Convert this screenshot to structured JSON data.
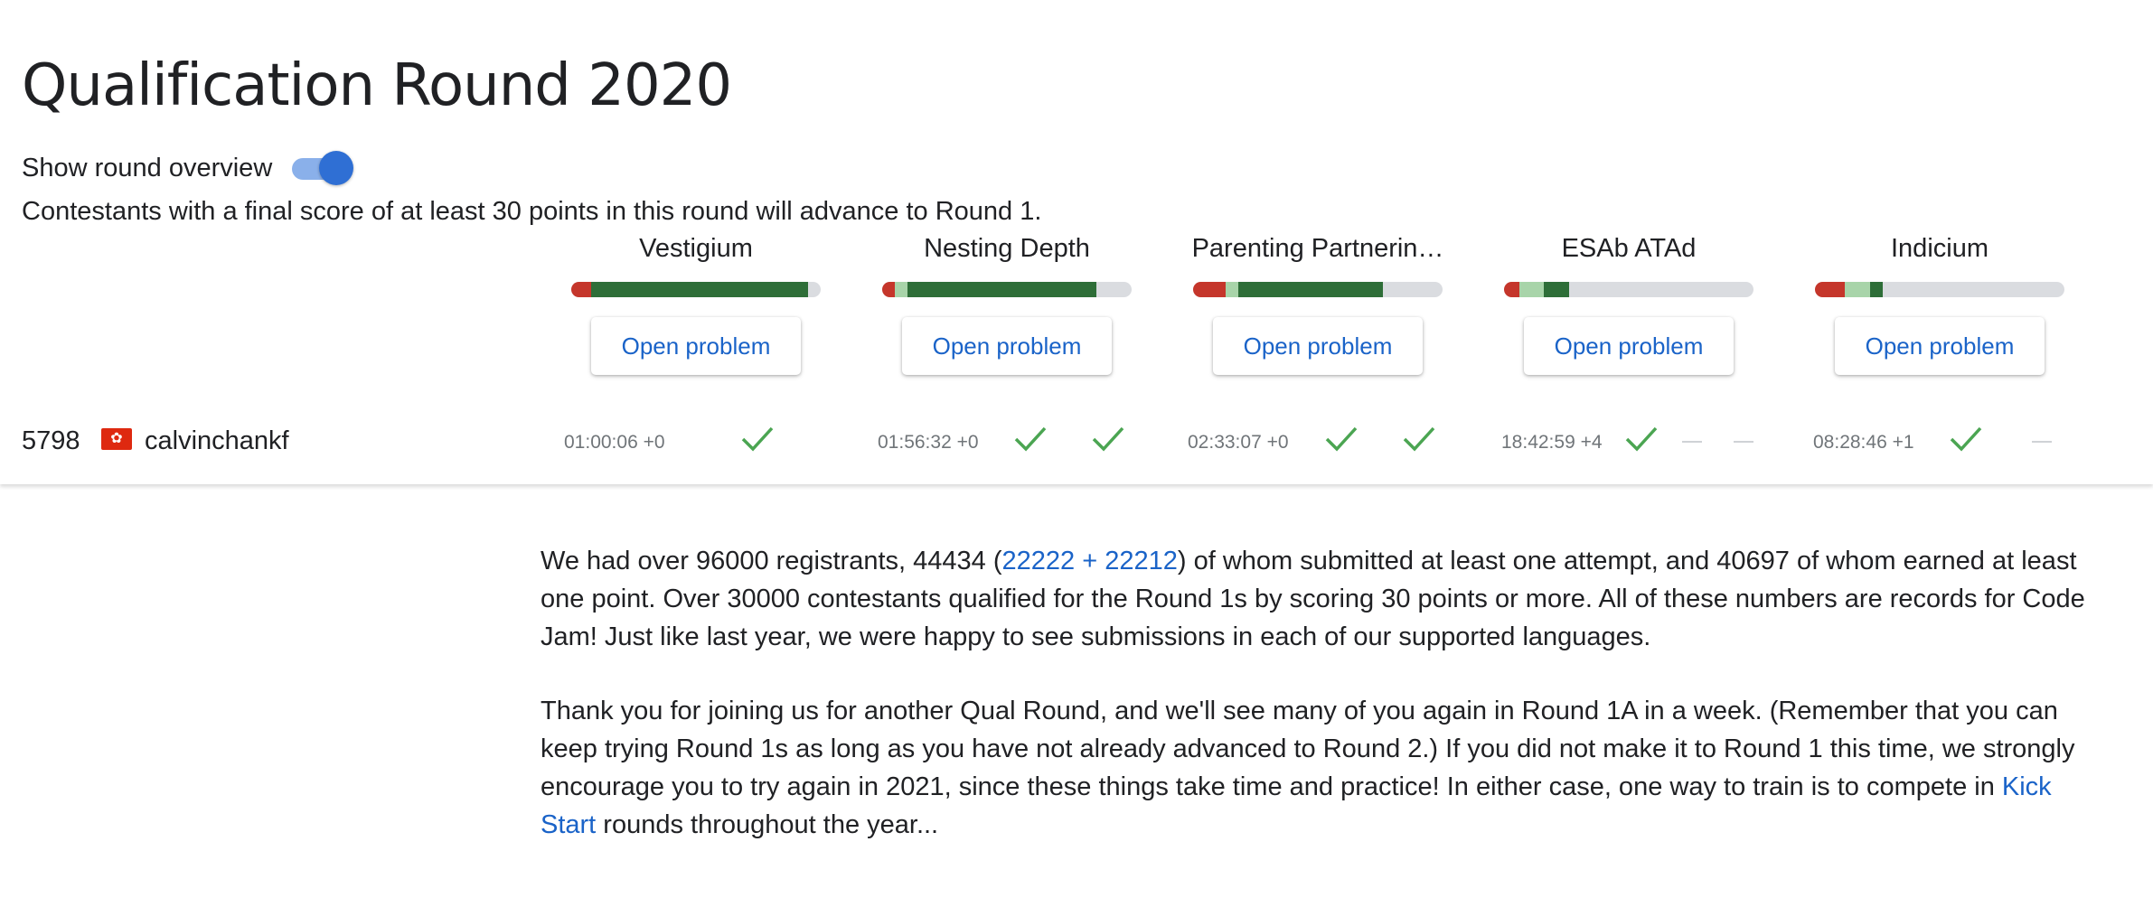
{
  "round": {
    "title": "Qualification Round 2020",
    "overview_label": "Show round overview",
    "overview_on": true,
    "advance_note": "Contestants with a final score of at least 30 points in this round will advance to Round 1."
  },
  "colors": {
    "wrong": "#c5362b",
    "correct_light": "#a8d4a9",
    "correct_dark": "#2e6e38",
    "empty": "#dadce0",
    "link": "#1a63c8",
    "check": "#4ba552"
  },
  "problems": [
    {
      "name": "Vestigium",
      "button": "Open problem",
      "bar_fractions": {
        "wrong": 0.08,
        "correct_light": 0.0,
        "correct_dark": 0.87
      },
      "time": "01:00:06 +0",
      "sets": [
        "check"
      ]
    },
    {
      "name": "Nesting Depth",
      "button": "Open problem",
      "bar_fractions": {
        "wrong": 0.05,
        "correct_light": 0.05,
        "correct_dark": 0.76
      },
      "time": "01:56:32 +0",
      "sets": [
        "check",
        "check"
      ]
    },
    {
      "name": "Parenting Partnerin…",
      "button": "Open problem",
      "bar_fractions": {
        "wrong": 0.13,
        "correct_light": 0.05,
        "correct_dark": 0.58
      },
      "time": "02:33:07 +0",
      "sets": [
        "check",
        "check"
      ]
    },
    {
      "name": "ESAb ATAd",
      "button": "Open problem",
      "bar_fractions": {
        "wrong": 0.06,
        "correct_light": 0.1,
        "correct_dark": 0.1
      },
      "time": "18:42:59 +4",
      "sets": [
        "check",
        "dash",
        "dash"
      ]
    },
    {
      "name": "Indicium",
      "button": "Open problem",
      "bar_fractions": {
        "wrong": 0.12,
        "correct_light": 0.1,
        "correct_dark": 0.05
      },
      "time": "08:28:46 +1",
      "sets": [
        "check",
        "dash"
      ]
    }
  ],
  "user": {
    "rank": "5798",
    "flag_icon": "hong-kong-flag-icon",
    "username": "calvinchankf"
  },
  "article": {
    "p1_before": "We had over 96000 registrants, 44434 (",
    "p1_link": "22222 + 22212",
    "p1_after": ") of whom submitted at least one attempt, and 40697 of whom earned at least one point. Over 30000 contestants qualified for the Round 1s by scoring 30 points or more. All of these numbers are records for Code Jam! Just like last year, we were happy to see submissions in each of our supported languages.",
    "p2_before": "Thank you for joining us for another Qual Round, and we'll see many of you again in Round 1A in a week. (Remember that you can keep trying Round 1s as long as you have not already advanced to Round 2.) If you did not make it to Round 1 this time, we strongly encourage you to try again in 2021, since these things take time and practice! In either case, one way to train is to compete in ",
    "p2_link": "Kick Start",
    "p2_after": " rounds throughout the year..."
  }
}
